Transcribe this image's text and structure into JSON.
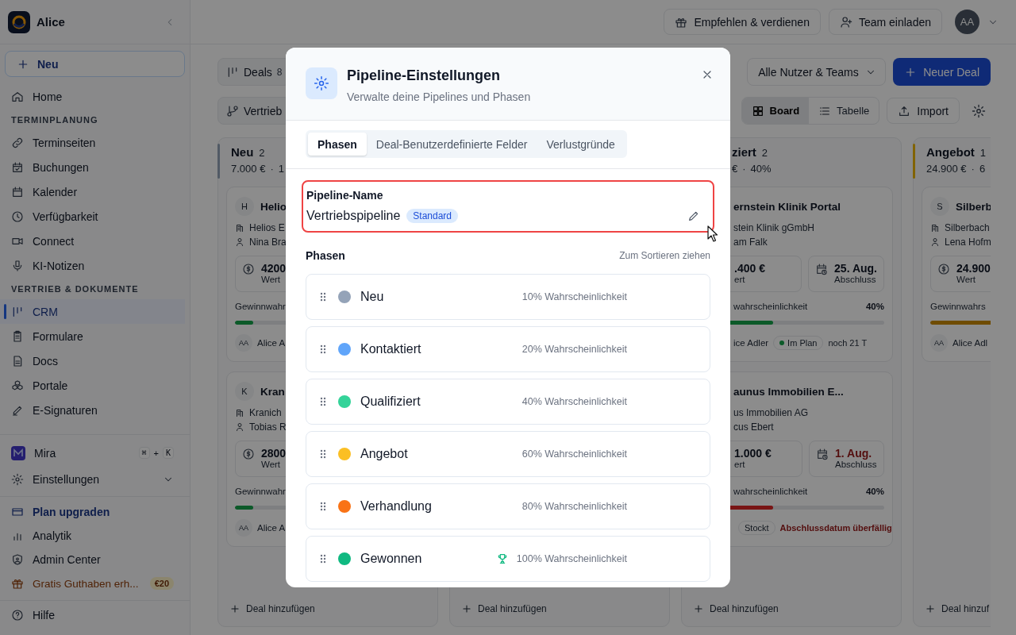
{
  "sidebar": {
    "workspace": "Alice",
    "new_button": "Neu",
    "nav": [
      {
        "kind": "item",
        "label": "Home",
        "selected": false
      },
      {
        "kind": "section",
        "label": "TERMINPLANUNG"
      },
      {
        "kind": "item",
        "label": "Terminseiten",
        "selected": false
      },
      {
        "kind": "item",
        "label": "Buchungen",
        "selected": false
      },
      {
        "kind": "item",
        "label": "Kalender",
        "selected": false
      },
      {
        "kind": "item",
        "label": "Verfügbarkeit",
        "selected": false
      },
      {
        "kind": "item",
        "label": "Connect",
        "selected": false
      },
      {
        "kind": "item",
        "label": "KI-Notizen",
        "selected": false
      },
      {
        "kind": "section",
        "label": "VERTRIEB & DOKUMENTE"
      },
      {
        "kind": "item",
        "label": "CRM",
        "selected": true
      },
      {
        "kind": "item",
        "label": "Formulare",
        "selected": false
      },
      {
        "kind": "item",
        "label": "Docs",
        "selected": false
      },
      {
        "kind": "item",
        "label": "Portale",
        "selected": false
      },
      {
        "kind": "item",
        "label": "E-Signaturen",
        "selected": false
      }
    ],
    "assistant": {
      "label": "Mira",
      "keys": [
        "⌘",
        "K"
      ],
      "joiner": "+"
    },
    "settings": {
      "label": "Einstellungen",
      "expanded": false
    },
    "footer": [
      {
        "kind": "upgrade",
        "label": "Plan upgraden"
      },
      {
        "kind": "item",
        "label": "Analytik"
      },
      {
        "kind": "item",
        "label": "Admin Center"
      },
      {
        "kind": "promo",
        "label": "Gratis Guthaben erh...",
        "badge": "€20"
      }
    ],
    "help": "Hilfe"
  },
  "topbar": {
    "buttons": [
      "Empfehlen & verdienen",
      "Team einladen"
    ],
    "avatar": "AA"
  },
  "toolbar": {
    "deals": {
      "label": "Deals",
      "count": "8"
    },
    "pipeline": "Vertrieb",
    "filter": "Alle Nutzer & Teams",
    "new_deal": "Neuer Deal",
    "views": [
      {
        "label": "Board",
        "selected": true
      },
      {
        "label": "Tabelle",
        "selected": false
      }
    ],
    "import": "Import"
  },
  "board": {
    "columns": [
      {
        "title": "Neu",
        "count": "2",
        "total": "7.000 €",
        "sep": "·",
        "prob": "1",
        "color": "#515a65",
        "add": "Deal hinzufügen",
        "cards": [
          {
            "avatar": "H",
            "title": "Helio",
            "company": "Helios E",
            "contact": "Nina Bra",
            "value": "4200",
            "value_label": "Wert",
            "prob_label": "Gewinnwahr",
            "level": 0.1,
            "color": "#0c5a29",
            "owner_initials": "AA",
            "owner": "Alice A"
          },
          {
            "avatar": "K",
            "title": "Kran",
            "company": "Kranich",
            "contact": "Tobias R",
            "value": "2800",
            "value_label": "Wert",
            "prob_label": "Gewinnwahr",
            "level": 0.1,
            "color": "#0c5a29",
            "owner_initials": "AA",
            "owner": "Alice A"
          }
        ]
      },
      {
        "add": "Deal hinzufügen"
      },
      {
        "title": "ziert",
        "count": "2",
        "total": "€",
        "sep": "·",
        "prob": "40%",
        "add": "Deal hinzufügen",
        "cards": [
          {
            "title": "ernstein Klinik Portal",
            "company": "stein Klinik gGmbH",
            "contact": "am Falk",
            "value": ".400 €",
            "value_label": "ert",
            "date": "25. Aug.",
            "date_label": "Abschluss",
            "overdue": false,
            "prob_label": "wahrscheinlichkeit",
            "prob": "40%",
            "level": 0.4,
            "color": "#0c5a29",
            "owner": "ice Adler",
            "status": {
              "label": "Im Plan",
              "color": "#0c5a29"
            },
            "note": "noch 21 T"
          },
          {
            "title": "aunus Immobilien E...",
            "company": "us Immobilien AG",
            "contact": "cus Ebert",
            "value": "1.000 €",
            "value_label": "ert",
            "date": "1. Aug.",
            "date_label": "Abschluss",
            "overdue": true,
            "prob_label": "wahrscheinlichkeit",
            "prob": "40%",
            "level": 0.4,
            "color": "#791515",
            "status": {
              "label": "Stockt"
            },
            "note": "Abschlussdatum überfällig"
          }
        ]
      },
      {
        "title": "Angebot",
        "count": "1",
        "total": "24.900 €",
        "sep": "·",
        "prob": "6",
        "color": "#816304",
        "add": "Deal hinzuf",
        "cards": [
          {
            "avatar": "S",
            "title": "Silberb",
            "company": "Silberbach",
            "contact": "Lena Hofm",
            "value": "24.900",
            "value_label": "Wert",
            "prob_label": "Gewinnwahrs",
            "level": 0.6,
            "color": "#6f4c02",
            "owner_initials": "AA",
            "owner": "Alice Adl"
          }
        ]
      }
    ]
  },
  "modal": {
    "title": "Pipeline-Einstellungen",
    "subtitle": "Verwalte deine Pipelines und Phasen",
    "tabs": [
      {
        "label": "Phasen",
        "selected": true
      },
      {
        "label": "Deal-Benutzerdefinierte Felder",
        "selected": false
      },
      {
        "label": "Verlustgründe",
        "selected": false
      }
    ],
    "pipeline": {
      "label": "Pipeline-Name",
      "name": "Vertriebspipeline",
      "badge": "Standard",
      "highlighted": true
    },
    "phases_title": "Phasen",
    "phases_hint": "Zum Sortieren ziehen",
    "phases": [
      {
        "name": "Neu",
        "color": "#94a3b8",
        "probability": "10% Wahrscheinlichkeit",
        "won": false
      },
      {
        "name": "Kontaktiert",
        "color": "#60a5fa",
        "probability": "20% Wahrscheinlichkeit",
        "won": false
      },
      {
        "name": "Qualifiziert",
        "color": "#34d399",
        "probability": "40% Wahrscheinlichkeit",
        "won": false
      },
      {
        "name": "Angebot",
        "color": "#fbbf24",
        "probability": "60% Wahrscheinlichkeit",
        "won": false
      },
      {
        "name": "Verhandlung",
        "color": "#f97316",
        "probability": "80% Wahrscheinlichkeit",
        "won": false
      },
      {
        "name": "Gewonnen",
        "color": "#10b981",
        "probability": "100% Wahrscheinlichkeit",
        "won": true
      }
    ]
  }
}
